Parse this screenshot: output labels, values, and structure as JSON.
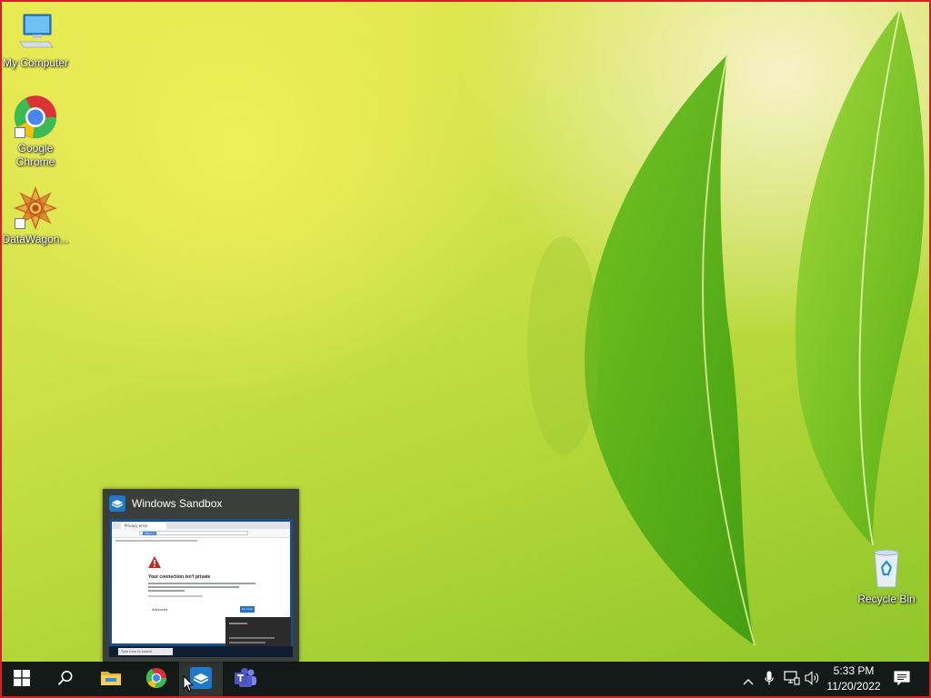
{
  "desktop": {
    "icons": [
      {
        "label": "My Computer",
        "icon": "monitor-icon"
      },
      {
        "label": "Google Chrome",
        "icon": "chrome-icon"
      },
      {
        "label": "DataWagon...",
        "icon": "datawagon-icon"
      },
      {
        "label": "Recycle Bin",
        "icon": "recycle-bin-icon"
      }
    ]
  },
  "preview": {
    "title": "Windows Sandbox",
    "inner": {
      "tab_label": "Privacy error",
      "address_text": "https://",
      "heading": "Your connection isn't private",
      "advanced_label": "Advanced",
      "go_back_label": "Go back",
      "search_placeholder": "Type here to search"
    }
  },
  "taskbar": {
    "buttons": [
      {
        "name": "start",
        "icon": "windows-logo-icon"
      },
      {
        "name": "search",
        "icon": "search-icon"
      },
      {
        "name": "file-explorer",
        "icon": "folder-icon"
      },
      {
        "name": "chrome",
        "icon": "chrome-icon"
      },
      {
        "name": "windows-sandbox",
        "icon": "sandbox-icon",
        "active": true
      },
      {
        "name": "teams",
        "icon": "teams-icon"
      }
    ],
    "tray": {
      "icons": [
        "chevron-up-icon",
        "microphone-icon",
        "network-icon",
        "volume-icon"
      ],
      "time": "5:33 PM",
      "date": "11/20/2022",
      "notification_icon": "notification-icon"
    }
  },
  "colors": {
    "taskbar_bg": "#141a17",
    "frame_border": "#d42020",
    "accent": "#0078d7"
  }
}
